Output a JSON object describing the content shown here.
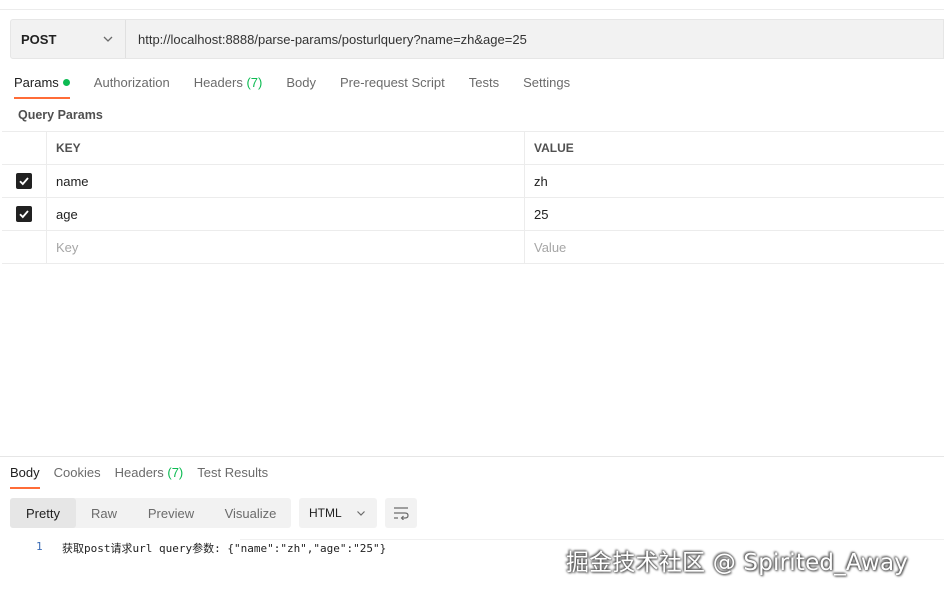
{
  "request": {
    "method": "POST",
    "url": "http://localhost:8888/parse-params/posturlquery?name=zh&age=25"
  },
  "request_tabs": [
    {
      "label": "Params",
      "active": true,
      "indicator_dot": true
    },
    {
      "label": "Authorization"
    },
    {
      "label": "Headers",
      "count": "(7)"
    },
    {
      "label": "Body"
    },
    {
      "label": "Pre-request Script"
    },
    {
      "label": "Tests"
    },
    {
      "label": "Settings"
    }
  ],
  "query_params": {
    "title": "Query Params",
    "columns": {
      "key": "KEY",
      "value": "VALUE"
    },
    "rows": [
      {
        "checked": true,
        "key": "name",
        "value": "zh"
      },
      {
        "checked": true,
        "key": "age",
        "value": "25"
      }
    ],
    "new_row": {
      "key_placeholder": "Key",
      "value_placeholder": "Value"
    }
  },
  "response_tabs": [
    {
      "label": "Body",
      "active": true
    },
    {
      "label": "Cookies"
    },
    {
      "label": "Headers",
      "count": "(7)"
    },
    {
      "label": "Test Results"
    }
  ],
  "view_modes": [
    "Pretty",
    "Raw",
    "Preview",
    "Visualize"
  ],
  "view_mode_active": "Pretty",
  "format": "HTML",
  "response_body": {
    "line_number": "1",
    "text": "获取post请求url query参数: {\"name\":\"zh\",\"age\":\"25\"}"
  },
  "watermark": "掘金技术社区 @ Spirited_Away",
  "colors": {
    "accent": "#ff6c37",
    "success_dot": "#0cbb52",
    "count_green": "#0cbb52",
    "line_number": "#3a6bb5"
  },
  "icons": {
    "method_dropdown": "chevron-down-icon",
    "format_dropdown": "chevron-down-icon",
    "wrap": "wrap-lines-icon",
    "checkbox": "checkmark-icon"
  }
}
